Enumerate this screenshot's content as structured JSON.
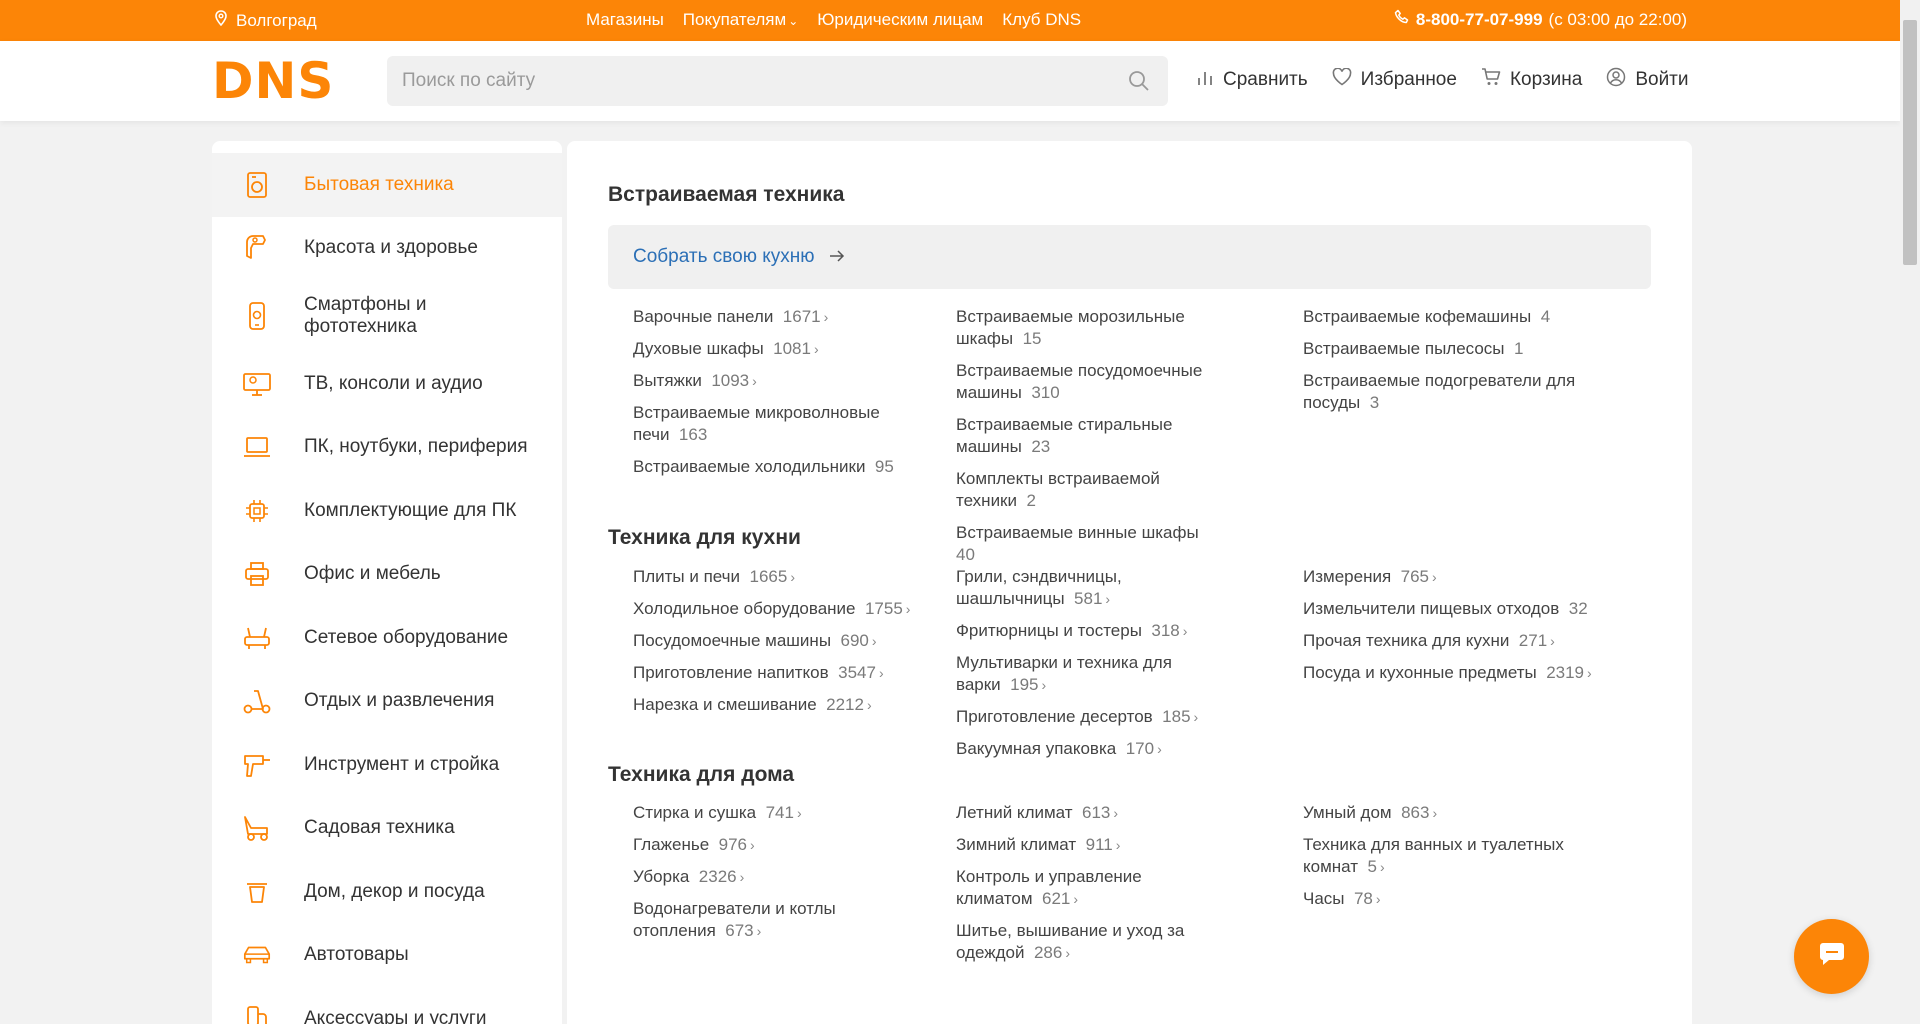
{
  "topbar": {
    "city": "Волгоград",
    "nav": [
      "Магазины",
      "Покупателям",
      "Юридическим лицам",
      "Клуб DNS"
    ],
    "phone": "8-800-77-07-999",
    "hours": "(с 03:00 до 22:00)"
  },
  "header": {
    "logo": "DNS",
    "search_placeholder": "Поиск по сайту",
    "actions": {
      "compare": "Сравнить",
      "favorites": "Избранное",
      "cart": "Корзина",
      "login": "Войти"
    }
  },
  "sidebar": {
    "items": [
      {
        "label": "Бытовая техника",
        "icon": "appliance-icon"
      },
      {
        "label": "Красота и здоровье",
        "icon": "hairdryer-icon"
      },
      {
        "label": "Смартфоны и фототехника",
        "icon": "smartphone-icon"
      },
      {
        "label": "ТВ, консоли и аудио",
        "icon": "tv-icon"
      },
      {
        "label": "ПК, ноутбуки, периферия",
        "icon": "laptop-icon"
      },
      {
        "label": "Комплектующие для ПК",
        "icon": "chip-icon"
      },
      {
        "label": "Офис и мебель",
        "icon": "printer-icon"
      },
      {
        "label": "Сетевое оборудование",
        "icon": "router-icon"
      },
      {
        "label": "Отдых и развлечения",
        "icon": "scooter-icon"
      },
      {
        "label": "Инструмент и стройка",
        "icon": "drill-icon"
      },
      {
        "label": "Садовая техника",
        "icon": "mower-icon"
      },
      {
        "label": "Дом, декор и посуда",
        "icon": "pot-icon"
      },
      {
        "label": "Автотовары",
        "icon": "car-icon"
      },
      {
        "label": "Аксессуары и услуги",
        "icon": "accessories-icon"
      }
    ]
  },
  "sections": {
    "builtin": {
      "title": "Встраиваемая техника",
      "banner": "Собрать свою кухню",
      "col1": [
        {
          "name": "Варочные панели",
          "count": "1671",
          "arrow": true
        },
        {
          "name": "Духовые шкафы",
          "count": "1081",
          "arrow": true
        },
        {
          "name": "Вытяжки",
          "count": "1093",
          "arrow": true
        },
        {
          "name": "Встраиваемые микроволновые печи",
          "count": "163",
          "arrow": false
        },
        {
          "name": "Встраиваемые холодильники",
          "count": "95",
          "arrow": false
        }
      ],
      "col2": [
        {
          "name": "Встраиваемые морозильные шкафы",
          "count": "15",
          "arrow": false
        },
        {
          "name": "Встраиваемые посудомоечные машины",
          "count": "310",
          "arrow": false
        },
        {
          "name": "Встраиваемые стиральные машины",
          "count": "23",
          "arrow": false
        },
        {
          "name": "Комплекты встраиваемой техники",
          "count": "2",
          "arrow": false
        },
        {
          "name": "Встраиваемые винные шкафы",
          "count": "40",
          "arrow": false
        }
      ],
      "col3": [
        {
          "name": "Встраиваемые кофемашины",
          "count": "4",
          "arrow": false
        },
        {
          "name": "Встраиваемые пылесосы",
          "count": "1",
          "arrow": false
        },
        {
          "name": "Встраиваемые подогреватели для посуды",
          "count": "3",
          "arrow": false
        }
      ]
    },
    "kitchen": {
      "title": "Техника для кухни",
      "col1": [
        {
          "name": "Плиты и печи",
          "count": "1665",
          "arrow": true
        },
        {
          "name": "Холодильное оборудование",
          "count": "1755",
          "arrow": true
        },
        {
          "name": "Посудомоечные машины",
          "count": "690",
          "arrow": true
        },
        {
          "name": "Приготовление напитков",
          "count": "3547",
          "arrow": true
        },
        {
          "name": "Нарезка и смешивание",
          "count": "2212",
          "arrow": true
        }
      ],
      "col2": [
        {
          "name": "Грили, сэндвичницы, шашлычницы",
          "count": "581",
          "arrow": true
        },
        {
          "name": "Фритюрницы и тостеры",
          "count": "318",
          "arrow": true
        },
        {
          "name": "Мультиварки и техника для варки",
          "count": "195",
          "arrow": true
        },
        {
          "name": "Приготовление десертов",
          "count": "185",
          "arrow": true
        },
        {
          "name": "Вакуумная упаковка",
          "count": "170",
          "arrow": true
        }
      ],
      "col3": [
        {
          "name": "Измерения",
          "count": "765",
          "arrow": true
        },
        {
          "name": "Измельчители пищевых отходов",
          "count": "32",
          "arrow": false
        },
        {
          "name": "Прочая техника для кухни",
          "count": "271",
          "arrow": true
        },
        {
          "name": "Посуда и кухонные предметы",
          "count": "2319",
          "arrow": true
        }
      ]
    },
    "home": {
      "title": "Техника для дома",
      "col1": [
        {
          "name": "Стирка и сушка",
          "count": "741",
          "arrow": true
        },
        {
          "name": "Глаженье",
          "count": "976",
          "arrow": true
        },
        {
          "name": "Уборка",
          "count": "2326",
          "arrow": true
        },
        {
          "name": "Водонагреватели и котлы отопления",
          "count": "673",
          "arrow": true
        }
      ],
      "col2": [
        {
          "name": "Летний климат",
          "count": "613",
          "arrow": true
        },
        {
          "name": "Зимний климат",
          "count": "911",
          "arrow": true
        },
        {
          "name": "Контроль и управление климатом",
          "count": "621",
          "arrow": true
        },
        {
          "name": "Шитье, вышивание и уход за одеждой",
          "count": "286",
          "arrow": true
        }
      ],
      "col3": [
        {
          "name": "Умный дом",
          "count": "863",
          "arrow": true
        },
        {
          "name": "Техника для ванных и туалетных комнат",
          "count": "5",
          "arrow": true
        },
        {
          "name": "Часы",
          "count": "78",
          "arrow": true
        }
      ]
    }
  },
  "colors": {
    "accent": "#fc8507",
    "link": "#2b6fb6",
    "text": "#333333",
    "count": "#7a7a7a"
  }
}
